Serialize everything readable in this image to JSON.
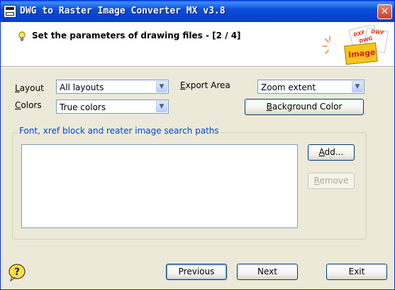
{
  "window": {
    "title": "DWG to Raster Image Converter MX v3.8",
    "close_glyph": "✕"
  },
  "header": {
    "title": "Set the parameters of drawing files  - [2 / 4]",
    "logo": {
      "tags": [
        "DXF",
        "DWF",
        "DWG"
      ],
      "label": "Image"
    }
  },
  "form": {
    "layout_label": "Layout",
    "layout_value": "All layouts",
    "colors_label": "Colors",
    "colors_value": "True colors",
    "export_area_label": "Export Area",
    "export_area_value": "Zoom extent",
    "background_color_button": "Background Color"
  },
  "paths": {
    "caption": "Font, xref block and reater image search paths",
    "items": [],
    "add_button": "Add...",
    "remove_button": "Remove"
  },
  "footer": {
    "previous_button": "Previous",
    "next_button": "Next",
    "exit_button": "Exit"
  },
  "colors": {
    "titlebar": "#0545d0",
    "group_caption": "#0046d5",
    "dialog_background": "#ece9d8"
  }
}
